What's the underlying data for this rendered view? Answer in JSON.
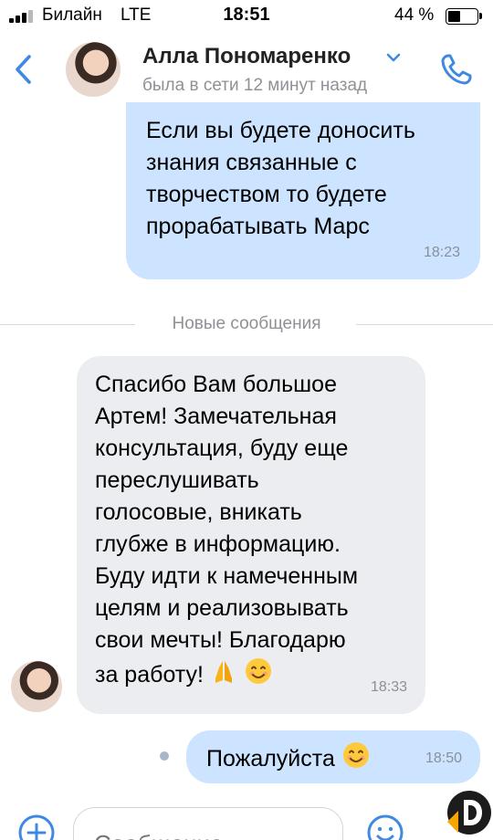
{
  "status_bar": {
    "carrier": "Билайн",
    "network": "LTE",
    "time": "18:51",
    "battery": "44 %",
    "battery_level": 0.44
  },
  "header": {
    "contact_name": "Алла Пономаренко",
    "last_seen": "была в сети 12 минут назад"
  },
  "messages": [
    {
      "direction": "outgoing",
      "text": "Если вы будете доносить знания связанные с творчеством то будете прорабатывать Марс",
      "time": "18:23"
    },
    {
      "direction": "incoming",
      "lines": [
        "Спасибо Вам большое",
        "Артем! Замечательная",
        "консультация, буду еще",
        "переслушивать",
        "голосовые, вникать",
        "глубже в информацию.",
        "Буду идти к намеченным",
        "целям и реализовывать",
        "свои мечты! Благодарю",
        "за работу!"
      ],
      "emojis": [
        "praying-hands",
        "smiling-face"
      ],
      "time": "18:33"
    },
    {
      "direction": "outgoing",
      "text": "Пожалуйста",
      "emojis": [
        "smiling-face"
      ],
      "time": "18:50"
    }
  ],
  "divider": {
    "label": "Новые сообщения"
  },
  "composer": {
    "placeholder": "Сообщение"
  },
  "colors": {
    "accent": "#3f8ae0",
    "outgoing_bubble": "#cce4ff",
    "incoming_bubble": "#ebedf0",
    "secondary_text": "#8e9196"
  }
}
